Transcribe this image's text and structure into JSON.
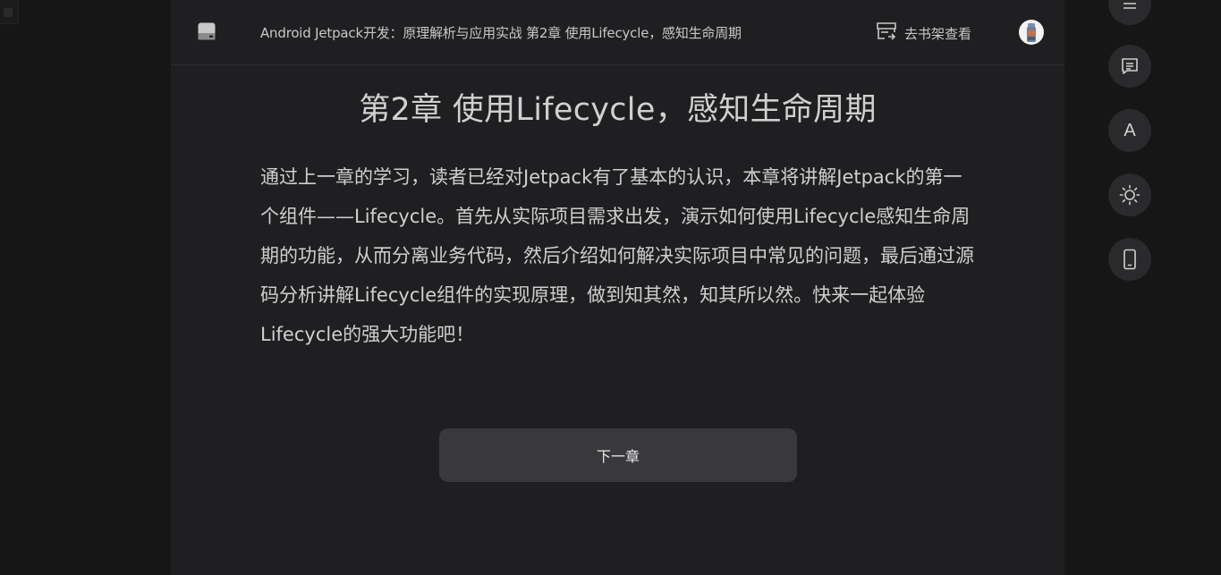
{
  "header": {
    "book_title": "Android Jetpack开发：原理解析与应用实战 第2章 使用Lifecycle，感知生命周期",
    "shelf_label": "去书架查看"
  },
  "chapter": {
    "title": "第2章 使用Lifecycle，感知生命周期",
    "body": "通过上一章的学习，读者已经对Jetpack有了基本的认识，本章将讲解Jetpack的第一个组件——Lifecycle。首先从实际项目需求出发，演示如何使用Lifecycle感知生命周期的功能，从而分离业务代码，然后介绍如何解决实际项目中常见的问题，最后通过源码分析讲解Lifecycle组件的实现原理，做到知其然，知其所以然。快来一起体验Lifecycle的强大功能吧！"
  },
  "next_button": {
    "label": "下一章"
  },
  "sidebar": {
    "items": [
      {
        "icon": "menu-icon"
      },
      {
        "icon": "comment-icon"
      },
      {
        "icon": "font-icon",
        "label": "A"
      },
      {
        "icon": "sun-icon"
      },
      {
        "icon": "phone-icon"
      }
    ]
  },
  "colors": {
    "page_bg": "#161617",
    "reader_bg": "#1f1f21",
    "button_bg": "#39393c",
    "side_btn_bg": "#2a2a2c"
  }
}
